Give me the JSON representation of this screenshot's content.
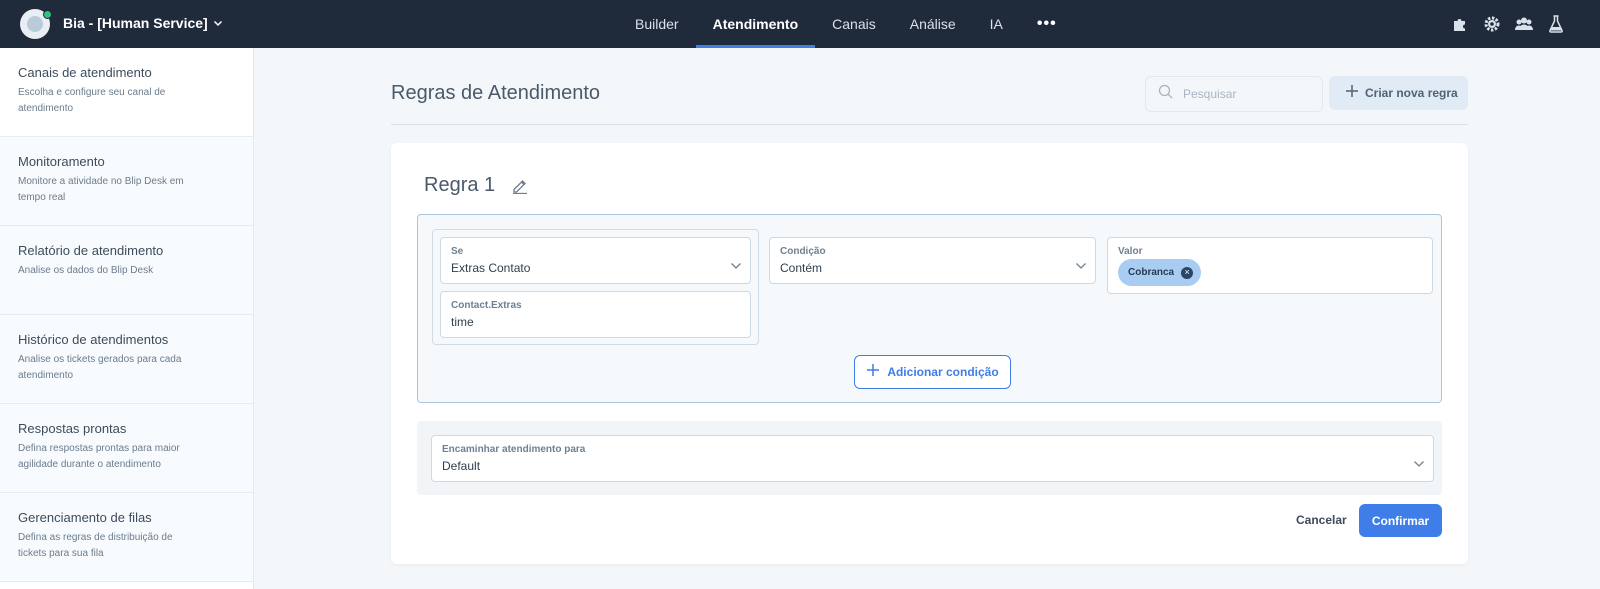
{
  "header": {
    "bot_name": "Bia - [Human Service]",
    "nav": [
      "Builder",
      "Atendimento",
      "Canais",
      "Análise",
      "IA"
    ],
    "active_nav": "Atendimento",
    "more": "•••",
    "icons": [
      "puzzle-icon",
      "gear-icon",
      "users-icon",
      "flask-icon"
    ]
  },
  "sidebar": {
    "items": [
      {
        "title": "Canais de atendimento",
        "desc": "Escolha e configure seu canal de atendimento"
      },
      {
        "title": "Monitoramento",
        "desc": "Monitore a atividade no Blip Desk em tempo real"
      },
      {
        "title": "Relatório de atendimento",
        "desc": "Analise os dados do Blip Desk"
      },
      {
        "title": "Histórico de atendimentos",
        "desc": "Analise os tickets gerados para cada atendimento"
      },
      {
        "title": "Respostas prontas",
        "desc": "Defina respostas prontas para maior agilidade durante o atendimento"
      },
      {
        "title": "Gerenciamento de filas",
        "desc": "Defina as regras de distribuição de tickets para sua fila"
      }
    ]
  },
  "main": {
    "title": "Regras de Atendimento",
    "search_placeholder": "Pesquisar",
    "new_rule_label": "Criar nova regra"
  },
  "rule": {
    "name": "Regra 1",
    "condition": {
      "se_label": "Se",
      "se_value": "Extras Contato",
      "extras_label": "Contact.Extras",
      "extras_value": "time",
      "condicao_label": "Condição",
      "condicao_value": "Contém",
      "valor_label": "Valor",
      "valor_chip": "Cobranca"
    },
    "add_condition_label": "Adicionar condição",
    "forward_label": "Encaminhar atendimento para",
    "forward_value": "Default",
    "cancel_label": "Cancelar",
    "confirm_label": "Confirmar"
  },
  "colors": {
    "topbar": "#1f2a3a",
    "accent": "#3f7de8",
    "chip": "#a9cdf2",
    "status_online": "#2ec27e"
  }
}
